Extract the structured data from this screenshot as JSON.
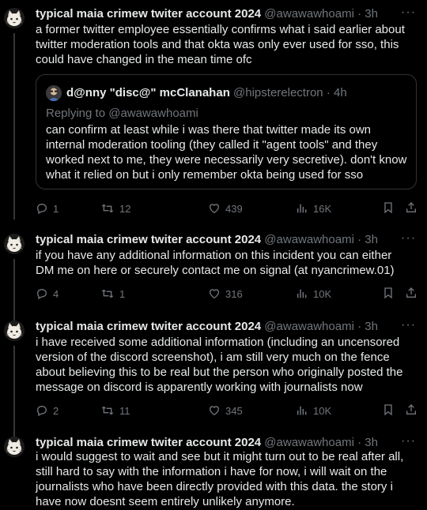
{
  "tweets": [
    {
      "author": "typical maia crimew twiter account 2024",
      "handle": "@awawawhoami",
      "time": "3h",
      "text": "a former twitter employee essentially confirms what i said earlier about twitter moderation tools and that okta was only ever used for sso, this could have changed in the mean time ofc",
      "quote": {
        "author": "d@nny \"disc@\" mcClanahan",
        "handle": "@hipsterelectron",
        "time": "4h",
        "reply_prefix": "Replying to ",
        "reply_handle": "@awawawhoami",
        "text": "can confirm at least while i was there that twitter made its own internal moderation tooling (they called it \"agent tools\" and they worked next to me, they were necessarily very secretive). don't know what it relied on but i only remember okta being used for sso"
      },
      "replies": "1",
      "retweets": "12",
      "likes": "439",
      "views": "16K"
    },
    {
      "author": "typical maia crimew twiter account 2024",
      "handle": "@awawawhoami",
      "time": "3h",
      "text": "if you have any additional information on this incident you can either DM me on here or securely contact me on signal (at nyancrimew.01)",
      "replies": "4",
      "retweets": "1",
      "likes": "316",
      "views": "10K"
    },
    {
      "author": "typical maia crimew twiter account 2024",
      "handle": "@awawawhoami",
      "time": "3h",
      "text": "i have received some additional information (including an uncensored version of the discord screenshot), i am still very much on the fence about believing this to be real but the person who originally posted the message on discord is apparently working with journalists now",
      "replies": "2",
      "retweets": "11",
      "likes": "345",
      "views": "10K"
    },
    {
      "author": "typical maia crimew twiter account 2024",
      "handle": "@awawawhoami",
      "time": "3h",
      "text": "i would suggest to wait and see but it might turn out to be real after all, still hard to say with the information i have for now, i will wait on the journalists who have been directly provided with this data. the story i have now doesnt seem entirely unlikely anymore."
    }
  ],
  "separator": " · ",
  "more_glyph": "···",
  "icons": [
    "reply-icon",
    "retweet-icon",
    "like-icon",
    "views-icon",
    "bookmark-icon",
    "share-icon",
    "more-icon"
  ],
  "colors": {
    "background": "#000000",
    "text": "#e7e9ea",
    "muted": "#71767b",
    "border": "#2f3336"
  }
}
